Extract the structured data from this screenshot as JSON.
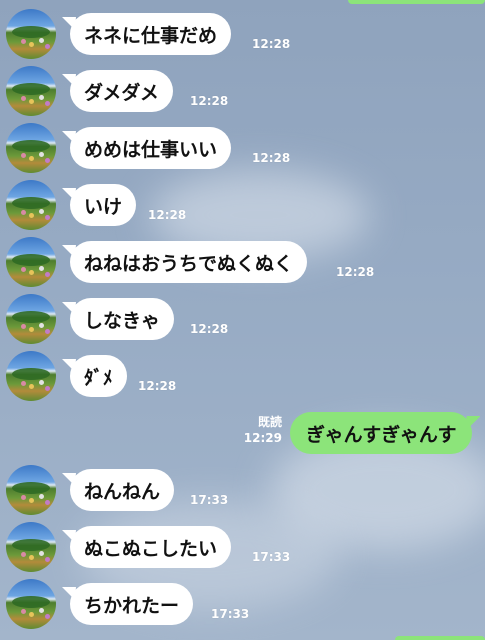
{
  "chat": {
    "messages": [
      {
        "text": "ネネに仕事だめ",
        "time": "12:28"
      },
      {
        "text": "ダメダメ",
        "time": "12:28"
      },
      {
        "text": "めめは仕事いい",
        "time": "12:28"
      },
      {
        "text": "いけ",
        "time": "12:28"
      },
      {
        "text": "ねねはおうちでぬくぬく",
        "time": "12:28"
      },
      {
        "text": "しなきゃ",
        "time": "12:28"
      },
      {
        "text": "ﾀﾞﾒ",
        "time": "12:28"
      },
      {
        "text": "ぎゃんすぎゃんす",
        "time": "12:29",
        "read": "既読"
      },
      {
        "text": "ねんねん",
        "time": "17:33"
      },
      {
        "text": "ぬこぬこしたい",
        "time": "17:33"
      },
      {
        "text": "ちかれたー",
        "time": "17:33"
      }
    ]
  }
}
